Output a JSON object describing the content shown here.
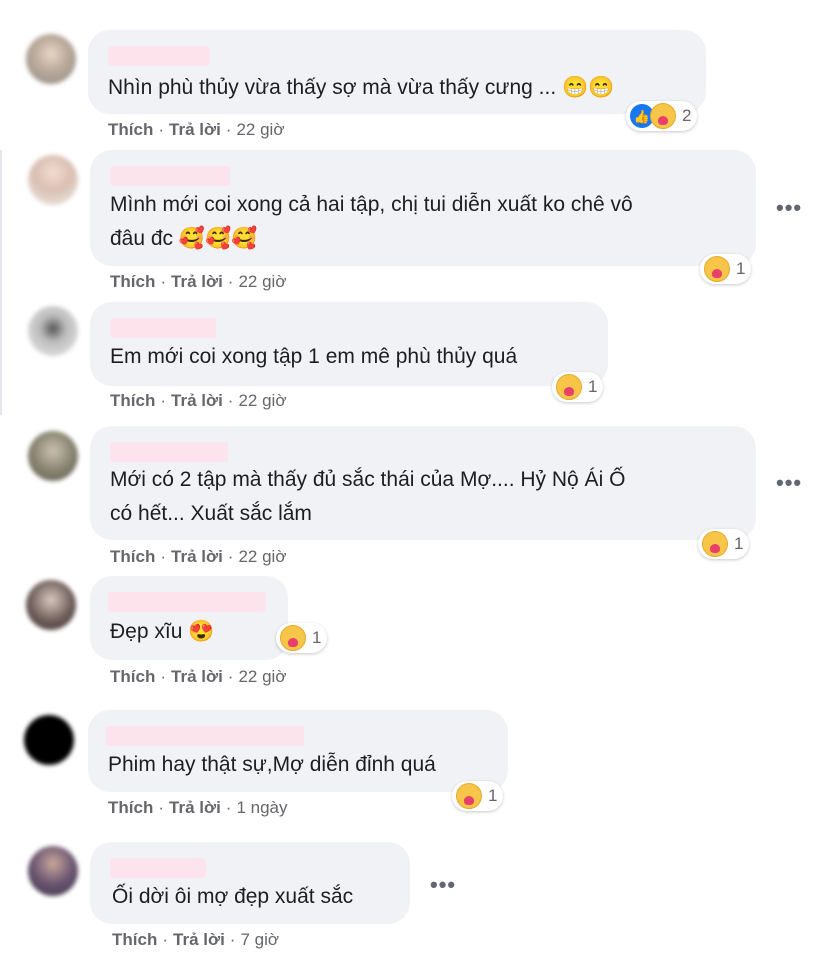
{
  "comments": [
    {
      "text": "Nhìn phù thủy vừa thấy sợ mà vừa thấy cưng ... 😁😁",
      "reaction_count": "2",
      "time": "22 giờ"
    },
    {
      "text_line1": "Mình mới coi xong cả hai tập, chị tui diễn xuất ko chê vô",
      "text_line2": "đâu đc 🥰🥰🥰",
      "reaction_count": "1",
      "time": "22 giờ"
    },
    {
      "text": "Em mới coi xong tập 1 em mê phù thủy quá",
      "reaction_count": "1",
      "time": "22 giờ"
    },
    {
      "text_line1": "Mới có 2 tập mà thấy đủ sắc thái của Mợ.... Hỷ Nộ Ái Ố",
      "text_line2": "có hết... Xuất sắc lắm",
      "reaction_count": "1",
      "time": "22 giờ"
    },
    {
      "text": "Đẹp xĩu 😍",
      "reaction_count": "1",
      "time": "22 giờ"
    },
    {
      "text": "Phim hay thật sự,Mợ diễn đỉnh quá",
      "reaction_count": "1",
      "time": "1 ngày"
    },
    {
      "text": "Ối dời ôi mợ đẹp xuất sắc",
      "time": "7 giờ"
    }
  ],
  "actions": {
    "like": "Thích",
    "reply": "Trả lời",
    "dot": "·"
  },
  "more_icon": "•••",
  "icons": {
    "like": "like-icon",
    "care": "care-reaction-icon",
    "more": "more-options-icon"
  }
}
